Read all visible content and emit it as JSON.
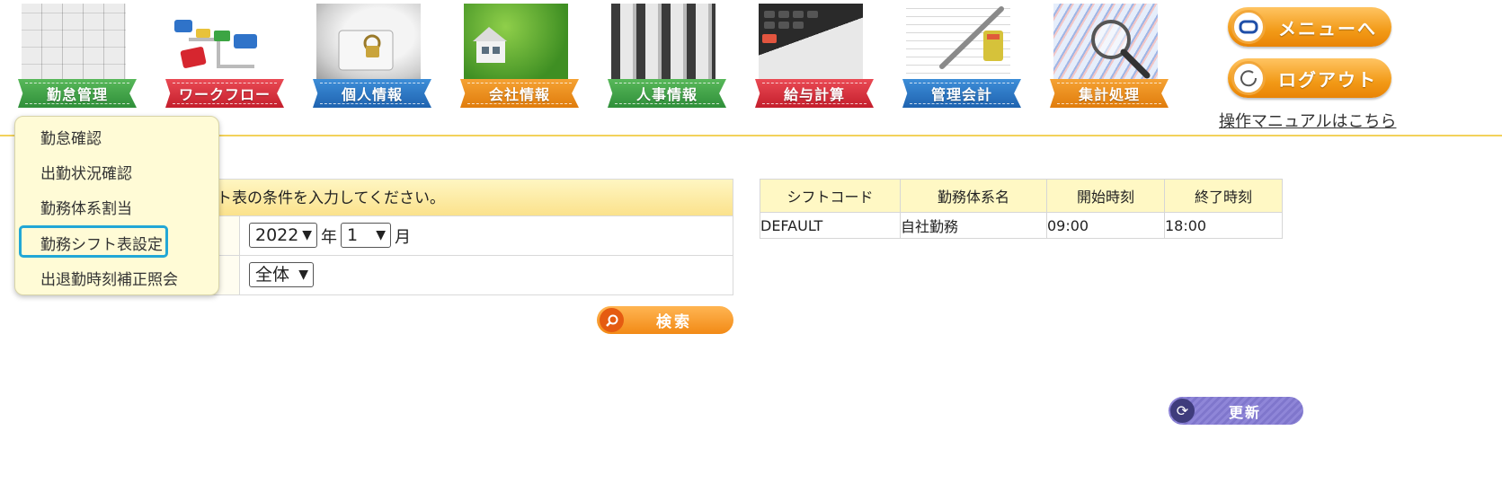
{
  "nav": {
    "items": [
      {
        "label": "勤怠管理",
        "icon": "calendar-photo-icon",
        "color": "#2f8f3a"
      },
      {
        "label": "ワークフロー",
        "icon": "workflow-diagram-icon",
        "color": "#c41e2c"
      },
      {
        "label": "個人情報",
        "icon": "padlock-book-icon",
        "color": "#1f63b0"
      },
      {
        "label": "会社情報",
        "icon": "house-on-grass-icon",
        "color": "#e07c0c"
      },
      {
        "label": "人事情報",
        "icon": "file-folders-icon",
        "color": "#2f8f3a"
      },
      {
        "label": "給与計算",
        "icon": "calculator-icon",
        "color": "#c41e2c"
      },
      {
        "label": "管理会計",
        "icon": "ledger-pen-icon",
        "color": "#1f63b0"
      },
      {
        "label": "集計処理",
        "icon": "chart-magnifier-icon",
        "color": "#e07c0c"
      }
    ],
    "menu_button": "メニューへ",
    "logout_button": "ログアウト",
    "manual_link": "操作マニュアルはこちら"
  },
  "dropdown": {
    "items": [
      "勤怠確認",
      "出勤状況確認",
      "勤務体系割当",
      "勤務シフト表設定",
      "出退勤時刻補正照会"
    ],
    "selected": "勤務シフト表設定"
  },
  "form": {
    "instruction": "勤務シフト表の条件を入力してください。",
    "instruction_visible": "ト表の条件を入力してください。",
    "year_value": "2022",
    "year_unit": "年",
    "month_value": "1",
    "month_unit": "月",
    "scope_value": "全体",
    "search_button": "検索"
  },
  "shift_table": {
    "headers": [
      "シフトコード",
      "勤務体系名",
      "開始時刻",
      "終了時刻"
    ],
    "rows": [
      [
        "DEFAULT",
        "自社勤務",
        "09:00",
        "18:00"
      ]
    ]
  },
  "update_button": "更新"
}
